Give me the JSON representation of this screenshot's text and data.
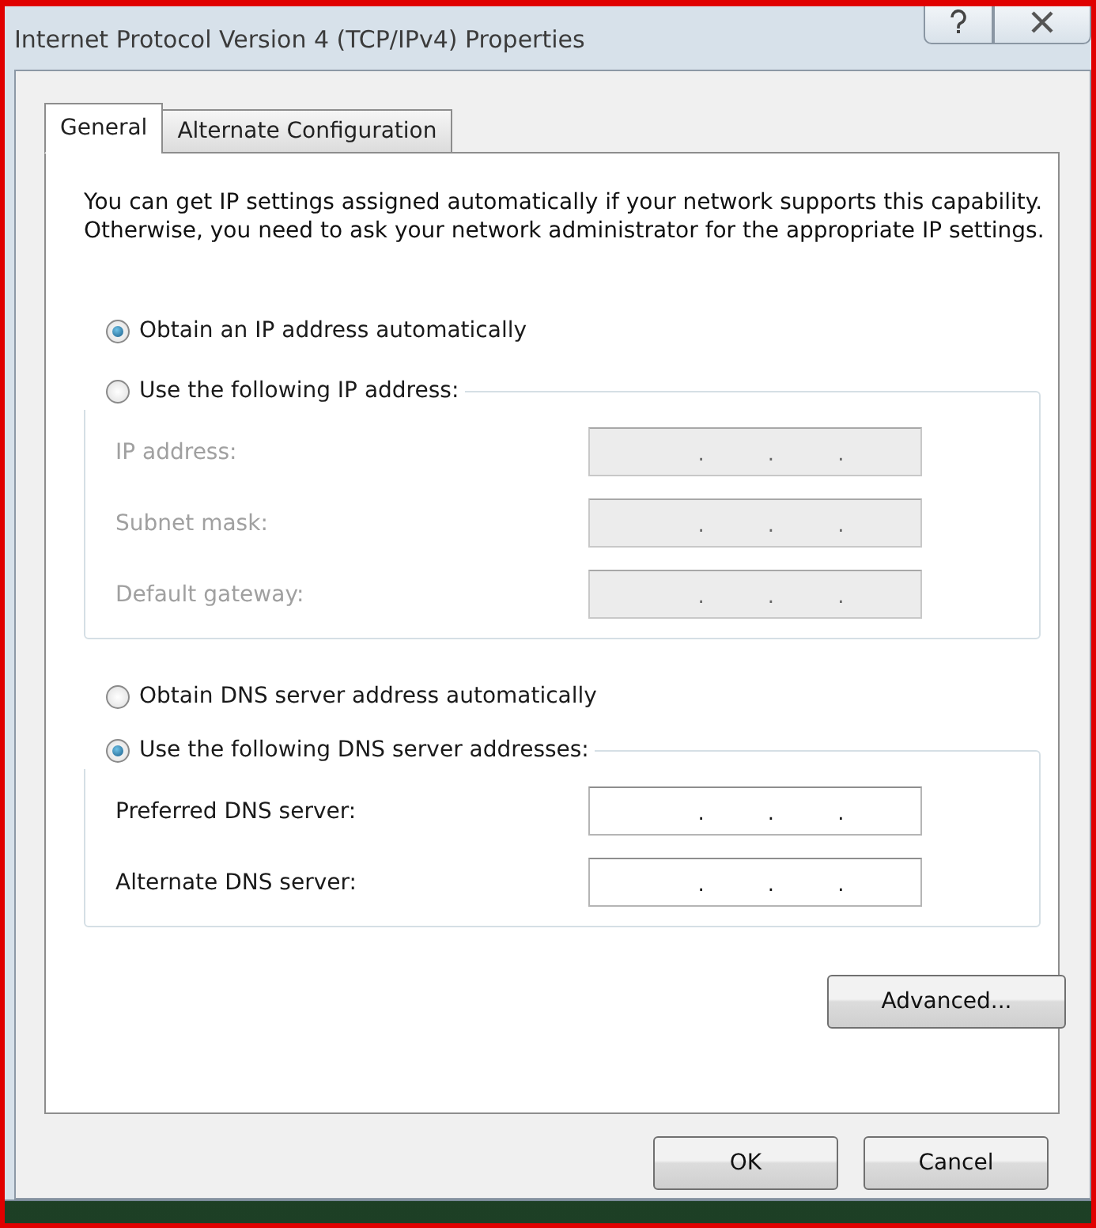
{
  "window": {
    "title": "Internet Protocol Version 4 (TCP/IPv4) Properties"
  },
  "tabs": [
    {
      "label": "General",
      "selected": true
    },
    {
      "label": "Alternate Configuration",
      "selected": false
    }
  ],
  "description": "You can get IP settings assigned automatically if your network supports this capability. Otherwise, you need to ask your network administrator for the appropriate IP settings.",
  "ip_section": {
    "auto_option": {
      "label": "Obtain an IP address automatically",
      "selected": true
    },
    "manual_option": {
      "label": "Use the following IP address:",
      "selected": false
    },
    "fields": [
      {
        "label": "IP address:",
        "disabled": true,
        "separators": [
          ".",
          ".",
          "."
        ]
      },
      {
        "label": "Subnet mask:",
        "disabled": true,
        "separators": [
          ".",
          ".",
          "."
        ]
      },
      {
        "label": "Default gateway:",
        "disabled": true,
        "separators": [
          ".",
          ".",
          "."
        ]
      }
    ]
  },
  "dns_section": {
    "auto_option": {
      "label": "Obtain DNS server address automatically",
      "selected": false
    },
    "manual_option": {
      "label": "Use the following DNS server addresses:",
      "selected": true
    },
    "fields": [
      {
        "label": "Preferred DNS server:",
        "disabled": false,
        "separators": [
          ".",
          ".",
          "."
        ]
      },
      {
        "label": "Alternate DNS server:",
        "disabled": false,
        "separators": [
          ".",
          ".",
          "."
        ]
      }
    ]
  },
  "advanced_button": "Advanced...",
  "buttons": [
    "OK",
    "Cancel"
  ]
}
